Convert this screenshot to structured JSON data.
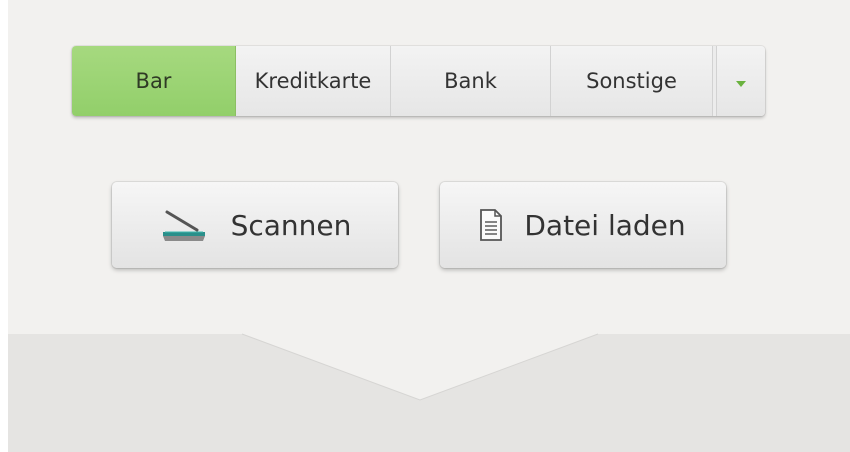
{
  "payment_methods": {
    "items": [
      {
        "label": "Bar",
        "selected": true
      },
      {
        "label": "Kreditkarte",
        "selected": false
      },
      {
        "label": "Bank",
        "selected": false
      },
      {
        "label": "Sonstige",
        "selected": false
      }
    ],
    "dropdown_icon": "chevron-down-icon"
  },
  "actions": {
    "scan": {
      "label": "Scannen",
      "icon": "scanner-icon"
    },
    "load_file": {
      "label": "Datei laden",
      "icon": "document-icon"
    }
  },
  "colors": {
    "selected_segment": "#9fd477",
    "panel_background": "#f2f1ef",
    "lower_background": "#e5e4e2",
    "accent_green": "#6ab23f"
  }
}
